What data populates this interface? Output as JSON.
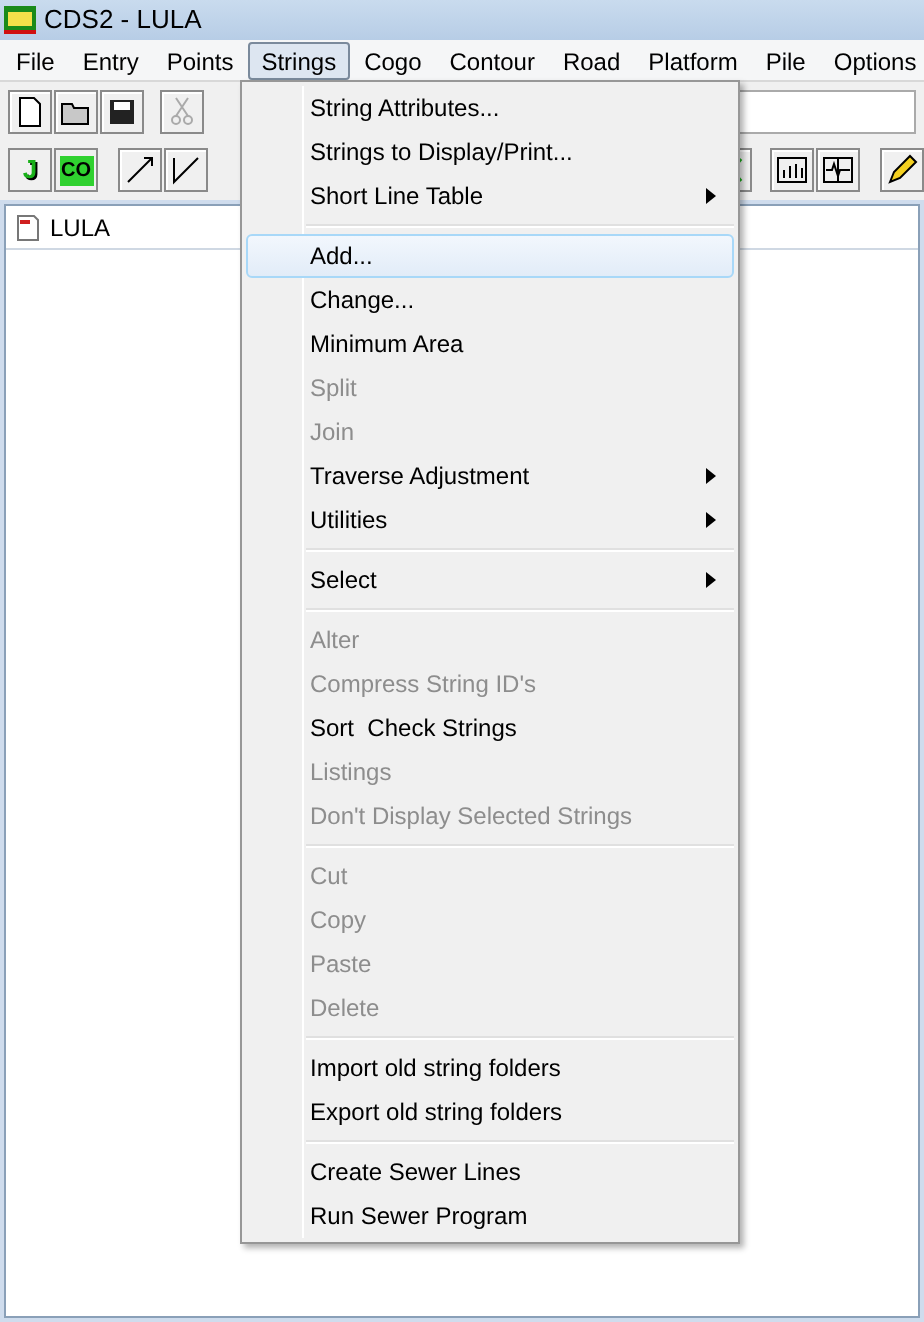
{
  "window": {
    "title": "CDS2 - LULA"
  },
  "menu_bar": [
    {
      "label": "File",
      "selected": false
    },
    {
      "label": "Entry",
      "selected": false
    },
    {
      "label": "Points",
      "selected": false
    },
    {
      "label": "Strings",
      "selected": true
    },
    {
      "label": "Cogo",
      "selected": false
    },
    {
      "label": "Contour",
      "selected": false
    },
    {
      "label": "Road",
      "selected": false
    },
    {
      "label": "Platform",
      "selected": false
    },
    {
      "label": "Pile",
      "selected": false
    },
    {
      "label": "Options",
      "selected": false
    }
  ],
  "toolbar_2": {
    "buttons": [
      "J",
      "CO"
    ]
  },
  "child_window": {
    "title": "LULA"
  },
  "strings_menu": [
    {
      "kind": "item",
      "label": "String Attributes...",
      "disabled": false,
      "submenu": false,
      "selected": false
    },
    {
      "kind": "item",
      "label": "Strings to Display/Print...",
      "disabled": false,
      "submenu": false,
      "selected": false
    },
    {
      "kind": "item",
      "label": "Short Line Table",
      "disabled": false,
      "submenu": true,
      "selected": false
    },
    {
      "kind": "separator"
    },
    {
      "kind": "item",
      "label": "Add...",
      "disabled": false,
      "submenu": false,
      "selected": true
    },
    {
      "kind": "item",
      "label": "Change...",
      "disabled": false,
      "submenu": false,
      "selected": false
    },
    {
      "kind": "item",
      "label": "Minimum Area",
      "disabled": false,
      "submenu": false,
      "selected": false
    },
    {
      "kind": "item",
      "label": "Split",
      "disabled": true,
      "submenu": false,
      "selected": false
    },
    {
      "kind": "item",
      "label": "Join",
      "disabled": true,
      "submenu": false,
      "selected": false
    },
    {
      "kind": "item",
      "label": "Traverse Adjustment",
      "disabled": false,
      "submenu": true,
      "selected": false
    },
    {
      "kind": "item",
      "label": "Utilities",
      "disabled": false,
      "submenu": true,
      "selected": false
    },
    {
      "kind": "separator"
    },
    {
      "kind": "item",
      "label": "Select",
      "disabled": false,
      "submenu": true,
      "selected": false
    },
    {
      "kind": "separator"
    },
    {
      "kind": "item",
      "label": "Alter",
      "disabled": true,
      "submenu": false,
      "selected": false
    },
    {
      "kind": "item",
      "label": "Compress String ID's",
      "disabled": true,
      "submenu": false,
      "selected": false
    },
    {
      "kind": "item",
      "label": "Sort  Check Strings",
      "disabled": false,
      "submenu": false,
      "selected": false
    },
    {
      "kind": "item",
      "label": "Listings",
      "disabled": true,
      "submenu": false,
      "selected": false
    },
    {
      "kind": "item",
      "label": "Don't Display Selected Strings",
      "disabled": true,
      "submenu": false,
      "selected": false
    },
    {
      "kind": "separator"
    },
    {
      "kind": "item",
      "label": "Cut",
      "disabled": true,
      "submenu": false,
      "selected": false
    },
    {
      "kind": "item",
      "label": "Copy",
      "disabled": true,
      "submenu": false,
      "selected": false
    },
    {
      "kind": "item",
      "label": "Paste",
      "disabled": true,
      "submenu": false,
      "selected": false
    },
    {
      "kind": "item",
      "label": "Delete",
      "disabled": true,
      "submenu": false,
      "selected": false
    },
    {
      "kind": "separator"
    },
    {
      "kind": "item",
      "label": "Import old string folders",
      "disabled": false,
      "submenu": false,
      "selected": false
    },
    {
      "kind": "item",
      "label": "Export old string folders",
      "disabled": false,
      "submenu": false,
      "selected": false
    },
    {
      "kind": "separator"
    },
    {
      "kind": "item",
      "label": "Create Sewer Lines",
      "disabled": false,
      "submenu": false,
      "selected": false
    },
    {
      "kind": "item",
      "label": "Run Sewer Program",
      "disabled": false,
      "submenu": false,
      "selected": false
    }
  ]
}
